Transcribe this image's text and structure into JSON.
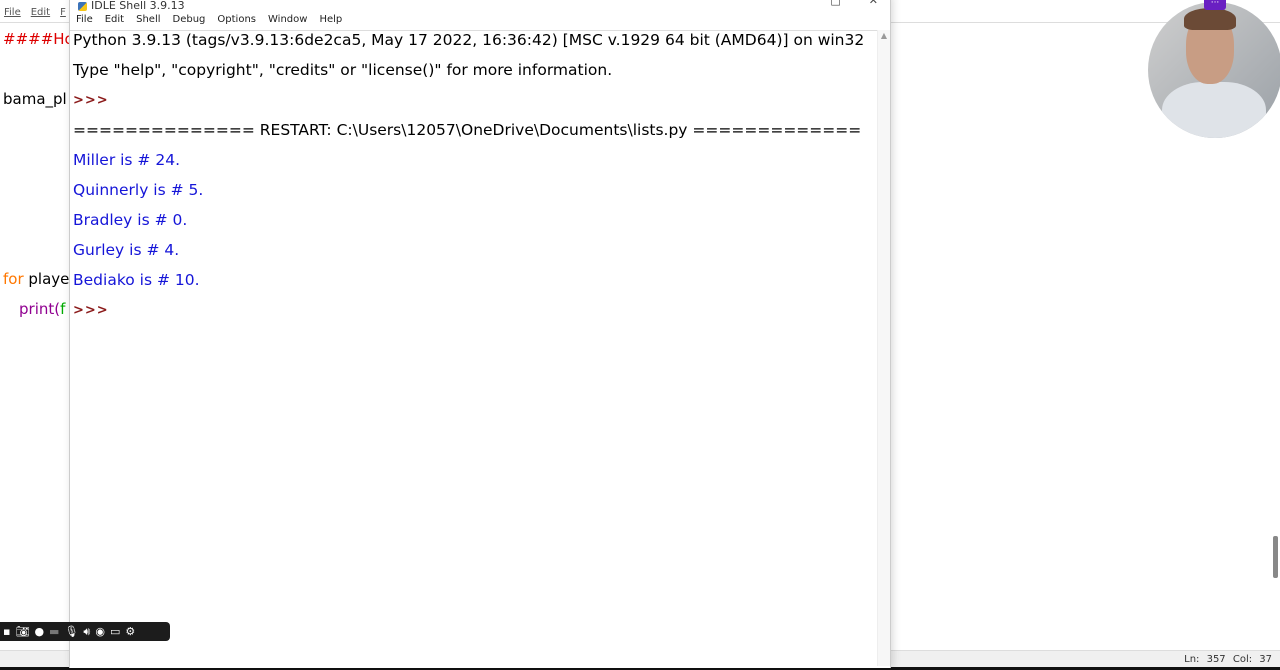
{
  "editor": {
    "menu": [
      "File",
      "Edit",
      "F"
    ],
    "code": [
      {
        "text": "####Hov",
        "color": "#dd0000"
      },
      {
        "text": "bama_pl",
        "color": "#000000"
      },
      {
        "text": "for",
        "color": "#ff7700",
        "rest": " playe"
      },
      {
        "text": "print(",
        "color": "#900090",
        "rest": "f"
      }
    ],
    "status": "Ln: 357 Col: 37"
  },
  "shell": {
    "title": "IDLE Shell 3.9.13",
    "menu": [
      "File",
      "Edit",
      "Shell",
      "Debug",
      "Options",
      "Window",
      "Help"
    ],
    "banner1": "Python 3.9.13 (tags/v3.9.13:6de2ca5, May 17 2022, 16:36:42) [MSC v.1929 64 bit (AMD64)] on win32",
    "banner2": "Type \"help\", \"copyright\", \"credits\" or \"license()\" for more information.",
    "prompt": ">>>",
    "restart": "============== RESTART: C:\\Users\\12057\\OneDrive\\Documents\\lists.py =============",
    "output": [
      "Miller is # 24.",
      "Quinnerly is # 5.",
      "Bradley is # 0.",
      "Gurley is # 4.",
      "Bediako is # 10."
    ]
  },
  "colors": {
    "output": "#1515d8",
    "prompt": "#8b1a1a",
    "cam_menu": "#6a1fc2"
  },
  "recorder": {
    "icons": [
      "screenshot-icon",
      "camera-icon",
      "record-icon",
      "mic-icon",
      "speaker-icon",
      "webcam-icon",
      "window-icon",
      "gear-icon"
    ]
  }
}
